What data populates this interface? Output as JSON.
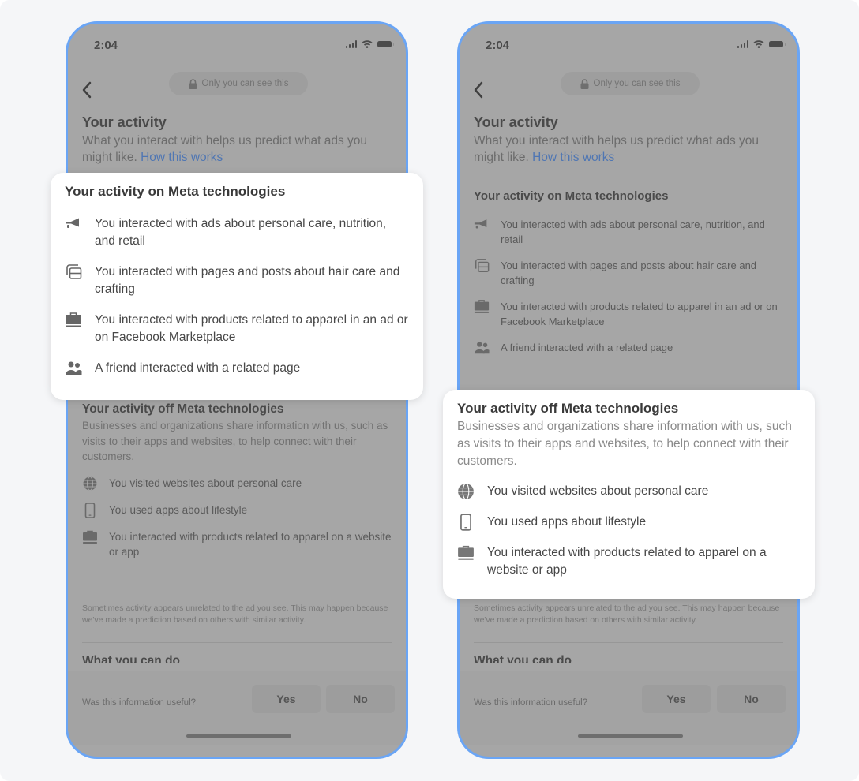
{
  "status_bar": {
    "time": "2:04",
    "icons": [
      "signal-icon",
      "wifi-icon",
      "battery-icon"
    ]
  },
  "nav": {
    "back_icon": "chevron-left-icon",
    "privacy_pill": "Only you can see this",
    "lock_icon": "lock-icon"
  },
  "header": {
    "title": "Your activity",
    "subtitle": "What you interact with helps us predict what ads you might like.",
    "link": "How this works"
  },
  "on_meta": {
    "title": "Your activity on Meta technologies",
    "items": [
      {
        "icon": "megaphone-icon",
        "text": "You interacted with ads about personal care, nutrition, and retail"
      },
      {
        "icon": "pages-icon",
        "text": "You interacted with pages and posts about hair care and crafting"
      },
      {
        "icon": "shopping-bag-icon",
        "text": "You interacted with products related to apparel in an ad or on Facebook Marketplace"
      },
      {
        "icon": "friends-icon",
        "text": "A friend interacted with a related page"
      }
    ]
  },
  "off_meta": {
    "title": "Your activity off Meta technologies",
    "description": "Businesses and organizations share information with us, such as visits to their apps and websites, to help connect with their customers.",
    "items": [
      {
        "icon": "globe-icon",
        "text": "You visited websites about personal care"
      },
      {
        "icon": "mobile-phone-icon",
        "text": "You used apps about lifestyle"
      },
      {
        "icon": "shopping-bag-icon",
        "text": "You interacted with products related to apparel on a website or app"
      }
    ]
  },
  "note": "Sometimes activity appears unrelated to the ad you see. This may happen because we've made a prediction based on others with similar activity.",
  "next_section_title": "What you can do",
  "feedback": {
    "question": "Was this information useful?",
    "yes": "Yes",
    "no": "No"
  },
  "colors": {
    "frame": "#6aa5f5",
    "link": "#4f76b3",
    "overlay": "#a6a6a6",
    "page_bg": "#f5f6f8"
  }
}
